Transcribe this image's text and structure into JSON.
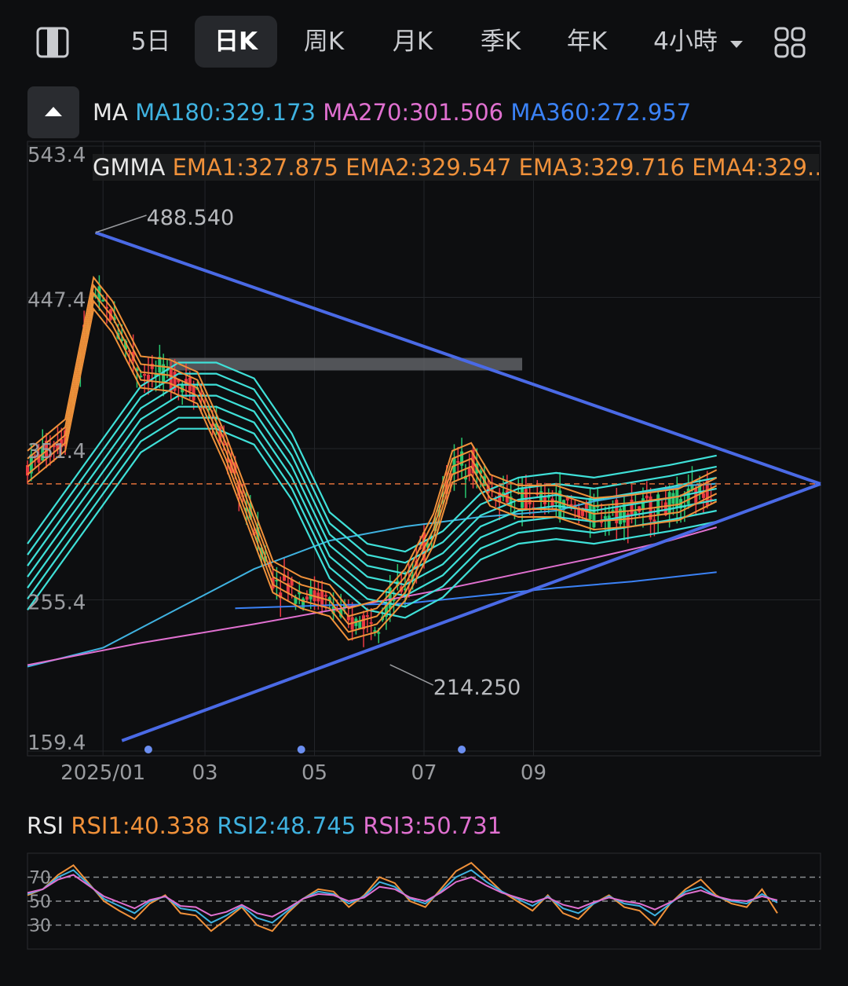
{
  "tabs": [
    {
      "label": "5日"
    },
    {
      "label": "日K",
      "active": true
    },
    {
      "label": "周K"
    },
    {
      "label": "月K"
    },
    {
      "label": "季K"
    },
    {
      "label": "年K"
    },
    {
      "label": "4小時"
    }
  ],
  "icons": {
    "left": "sidebar-toggle-icon",
    "dropdown": "caret-down-icon",
    "right": "grid-layout-icon",
    "collapse": "triangle-up-icon"
  },
  "ma_legend": {
    "label": "MA",
    "items": [
      {
        "text": "MA180:329.173",
        "color": "#3fb2e0"
      },
      {
        "text": "MA270:301.506",
        "color": "#e070d0"
      },
      {
        "text": "MA360:272.957",
        "color": "#3b82f6"
      }
    ]
  },
  "gmma_legend": {
    "label": "GMMA",
    "text": "EMA1:327.875 EMA2:329.547 EMA3:329.716 EMA4:329.…",
    "color": "#f0913a"
  },
  "rsi_legend": {
    "label": "RSI",
    "items": [
      {
        "text": "RSI1:40.338",
        "color": "#f0913a"
      },
      {
        "text": "RSI2:48.745",
        "color": "#3fb2e0"
      },
      {
        "text": "RSI3:50.731",
        "color": "#e070d0"
      }
    ]
  },
  "chart_data": [
    {
      "type": "candlestick",
      "y_ticks": [
        "543.4",
        "447.4",
        "351.4",
        "255.4",
        "159.4"
      ],
      "ylim": [
        159.4,
        543.4
      ],
      "x_ticks": [
        "2025/01",
        "03",
        "05",
        "07",
        "09"
      ],
      "annotations": [
        {
          "text": "488.540",
          "value": 488.54,
          "kind": "high"
        },
        {
          "text": "214.250",
          "value": 214.25,
          "kind": "low"
        }
      ],
      "last_price": 329.0,
      "resistance_level": 405.0,
      "series": [
        {
          "name": "MA180",
          "color": "#3fb2e0",
          "values": [
            [
              0,
              213
            ],
            [
              40,
              225
            ],
            [
              80,
              250
            ],
            [
              120,
              275
            ],
            [
              160,
              293
            ],
            [
              200,
              302
            ],
            [
              240,
              308
            ],
            [
              280,
              312
            ],
            [
              300,
              318
            ],
            [
              320,
              322
            ],
            [
              340,
              326
            ],
            [
              350,
              328
            ],
            [
              365,
              329.173
            ]
          ]
        },
        {
          "name": "MA270",
          "color": "#e070d0",
          "values": [
            [
              0,
              214
            ],
            [
              60,
              228
            ],
            [
              120,
              240
            ],
            [
              180,
              253
            ],
            [
              220,
              262
            ],
            [
              260,
              272
            ],
            [
              300,
              282
            ],
            [
              340,
              293
            ],
            [
              365,
              301.506
            ]
          ]
        },
        {
          "name": "MA360",
          "color": "#3b82f6",
          "values": [
            [
              110,
              250
            ],
            [
              160,
              252
            ],
            [
              200,
              253
            ],
            [
              240,
              258
            ],
            [
              280,
              263
            ],
            [
              320,
              267
            ],
            [
              365,
              272.957
            ]
          ]
        },
        {
          "name": "GMMA_long",
          "color": "#3fe0d8",
          "values": [
            [
              0,
              270
            ],
            [
              30,
              320
            ],
            [
              60,
              370
            ],
            [
              80,
              385
            ],
            [
              100,
              385
            ],
            [
              120,
              375
            ],
            [
              140,
              340
            ],
            [
              160,
              290
            ],
            [
              180,
              270
            ],
            [
              200,
              265
            ],
            [
              220,
              278
            ],
            [
              240,
              302
            ],
            [
              260,
              312
            ],
            [
              280,
              315
            ],
            [
              300,
              312
            ],
            [
              320,
              316
            ],
            [
              340,
              320
            ],
            [
              365,
              326
            ]
          ]
        },
        {
          "name": "GMMA_short",
          "color": "#f0913a",
          "values": [
            [
              0,
              340
            ],
            [
              20,
              360
            ],
            [
              35,
              450
            ],
            [
              45,
              435
            ],
            [
              60,
              400
            ],
            [
              75,
              398
            ],
            [
              90,
              390
            ],
            [
              105,
              350
            ],
            [
              130,
              270
            ],
            [
              145,
              260
            ],
            [
              160,
              255
            ],
            [
              170,
              240
            ],
            [
              185,
              245
            ],
            [
              200,
              265
            ],
            [
              215,
              300
            ],
            [
              225,
              340
            ],
            [
              235,
              345
            ],
            [
              245,
              325
            ],
            [
              260,
              318
            ],
            [
              280,
              318
            ],
            [
              300,
              310
            ],
            [
              320,
              312
            ],
            [
              345,
              316
            ],
            [
              365,
              327.875
            ]
          ]
        }
      ]
    },
    {
      "type": "line",
      "title": "RSI",
      "y_ticks": [
        "70",
        "50",
        "30"
      ],
      "ylim": [
        10,
        90
      ],
      "series": [
        {
          "name": "RSI1",
          "color": "#f0913a",
          "values": [
            55,
            60,
            72,
            80,
            65,
            50,
            42,
            35,
            48,
            55,
            40,
            38,
            25,
            35,
            45,
            30,
            25,
            40,
            52,
            60,
            58,
            45,
            55,
            70,
            65,
            50,
            45,
            60,
            75,
            82,
            70,
            58,
            50,
            42,
            55,
            40,
            35,
            48,
            55,
            45,
            42,
            30,
            48,
            60,
            68,
            55,
            48,
            45,
            60,
            40
          ]
        },
        {
          "name": "RSI2",
          "color": "#3fb2e0",
          "values": [
            56,
            60,
            70,
            76,
            64,
            52,
            46,
            40,
            50,
            54,
            44,
            42,
            32,
            38,
            46,
            36,
            32,
            42,
            52,
            58,
            56,
            48,
            54,
            66,
            62,
            52,
            48,
            58,
            70,
            76,
            66,
            58,
            52,
            46,
            54,
            44,
            40,
            48,
            54,
            48,
            46,
            38,
            48,
            58,
            62,
            54,
            50,
            48,
            56,
            48.745
          ]
        },
        {
          "name": "RSI3",
          "color": "#e070d0",
          "values": [
            57,
            60,
            68,
            72,
            63,
            54,
            49,
            44,
            51,
            54,
            46,
            45,
            38,
            41,
            47,
            40,
            37,
            44,
            52,
            56,
            55,
            50,
            53,
            62,
            60,
            53,
            50,
            57,
            66,
            70,
            63,
            57,
            53,
            49,
            53,
            47,
            44,
            49,
            53,
            50,
            48,
            43,
            49,
            56,
            59,
            54,
            51,
            50,
            54,
            50.731
          ]
        }
      ]
    }
  ]
}
